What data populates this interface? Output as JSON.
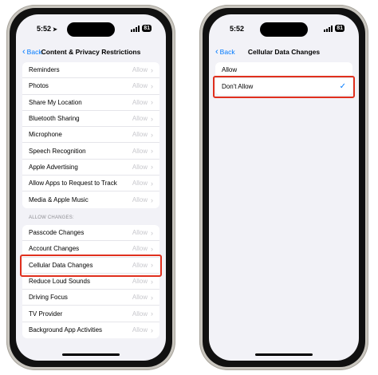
{
  "left": {
    "status": {
      "time": "5:52",
      "battery": "81"
    },
    "nav": {
      "back": "Back",
      "title": "Content & Privacy Restrictions"
    },
    "group1": [
      {
        "label": "Reminders",
        "value": "Allow"
      },
      {
        "label": "Photos",
        "value": "Allow"
      },
      {
        "label": "Share My Location",
        "value": "Allow"
      },
      {
        "label": "Bluetooth Sharing",
        "value": "Allow"
      },
      {
        "label": "Microphone",
        "value": "Allow"
      },
      {
        "label": "Speech Recognition",
        "value": "Allow"
      },
      {
        "label": "Apple Advertising",
        "value": "Allow"
      },
      {
        "label": "Allow Apps to Request to Track",
        "value": "Allow"
      },
      {
        "label": "Media & Apple Music",
        "value": "Allow"
      }
    ],
    "section_header": "ALLOW CHANGES:",
    "group2": [
      {
        "label": "Passcode Changes",
        "value": "Allow"
      },
      {
        "label": "Account Changes",
        "value": "Allow"
      },
      {
        "label": "Cellular Data Changes",
        "value": "Allow"
      },
      {
        "label": "Reduce Loud Sounds",
        "value": "Allow"
      },
      {
        "label": "Driving Focus",
        "value": "Allow"
      },
      {
        "label": "TV Provider",
        "value": "Allow"
      },
      {
        "label": "Background App Activities",
        "value": "Allow"
      }
    ]
  },
  "right": {
    "status": {
      "time": "5:52",
      "battery": "81"
    },
    "nav": {
      "back": "Back",
      "title": "Cellular Data Changes"
    },
    "options": [
      {
        "label": "Allow",
        "checked": false
      },
      {
        "label": "Don't Allow",
        "checked": true
      }
    ]
  },
  "colors": {
    "accent": "#007aff",
    "highlight": "#e0301e"
  }
}
